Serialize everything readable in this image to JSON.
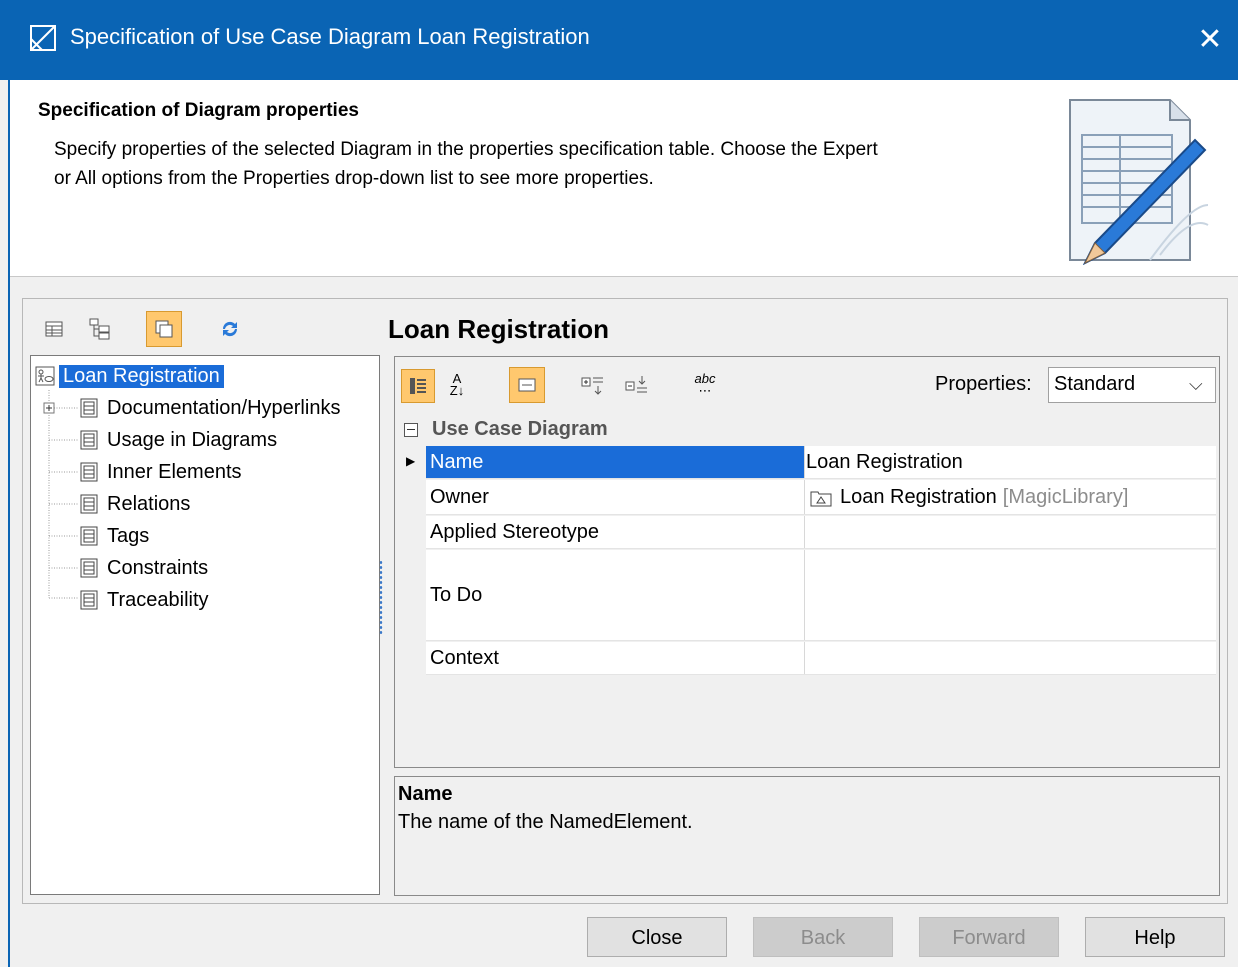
{
  "window": {
    "title": "Specification of Use Case Diagram Loan Registration",
    "close_glyph": "✕"
  },
  "header": {
    "heading": "Specification of Diagram properties",
    "description_line1": "Specify properties of the selected Diagram in the properties specification table. Choose the Expert",
    "description_line2": "or All options from the Properties drop-down list to see more properties."
  },
  "left_toolbar": [
    "table-view-icon",
    "tree-view-icon",
    "show-inherited-icon",
    "refresh-icon"
  ],
  "tree": {
    "root": "Loan Registration",
    "items": [
      {
        "label": "Documentation/Hyperlinks",
        "expandable": true
      },
      {
        "label": "Usage in Diagrams"
      },
      {
        "label": "Inner Elements"
      },
      {
        "label": "Relations"
      },
      {
        "label": "Tags"
      },
      {
        "label": "Constraints"
      },
      {
        "label": "Traceability"
      }
    ]
  },
  "right": {
    "title": "Loan Registration",
    "toolbar": [
      "categorized-icon",
      "sort-alpha-icon",
      "show-description-icon",
      "expand-all-icon",
      "collapse-all-icon",
      "spelling-icon"
    ],
    "properties_label": "Properties:",
    "properties_value": "Standard",
    "group": "Use Case Diagram",
    "rows": [
      {
        "name": "Name",
        "value": "Loan Registration",
        "selected": true
      },
      {
        "name": "Owner",
        "value": "Loan Registration",
        "owner_suffix": "[MagicLibrary]"
      },
      {
        "name": "Applied Stereotype",
        "value": ""
      },
      {
        "name": "To Do",
        "value": ""
      },
      {
        "name": "Context",
        "value": ""
      }
    ],
    "description_title": "Name",
    "description_text": "The name of the NamedElement."
  },
  "buttons": {
    "close": "Close",
    "back": "Back",
    "forward": "Forward",
    "help": "Help"
  },
  "colors": {
    "title_bar": "#0a64b4",
    "selection": "#1a6cd8",
    "toggle_on": "#ffc86e"
  }
}
